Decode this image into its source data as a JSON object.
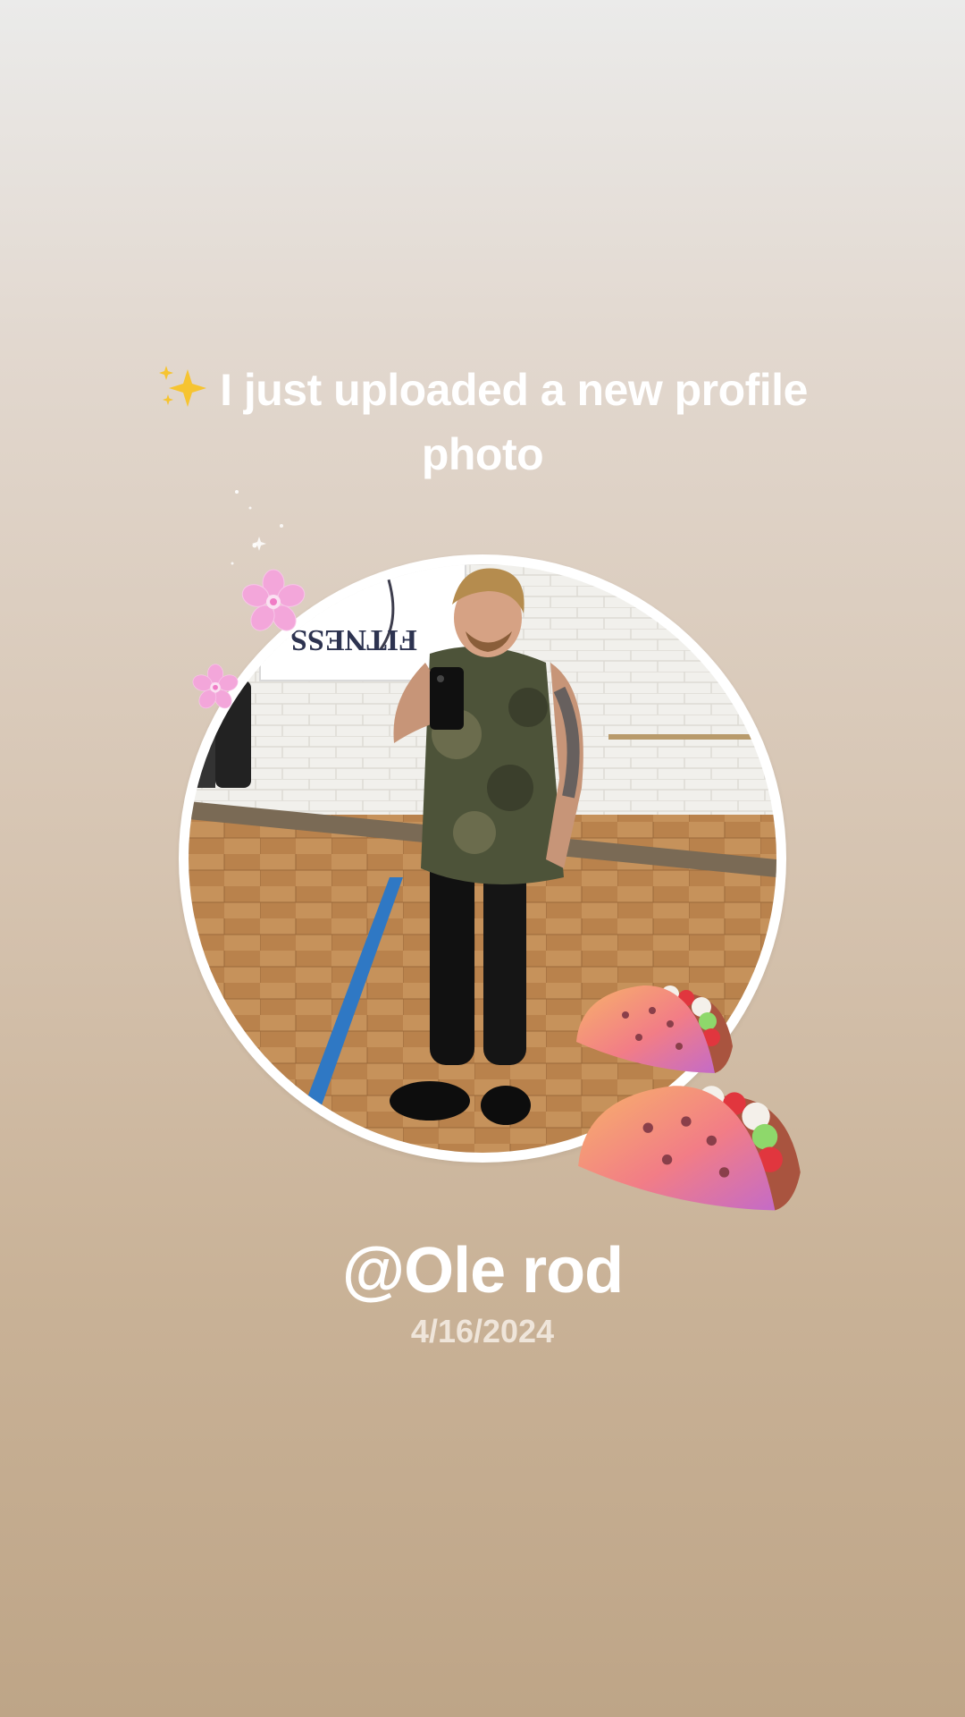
{
  "post": {
    "headline_icon": "sparkles-icon",
    "headline_text": "I just uploaded a new profile photo",
    "username": "@Ole rod",
    "date": "4/16/2024"
  },
  "stickers": [
    "sparkles-icon",
    "cherry-blossom-icon",
    "taco-icon"
  ],
  "photo": {
    "sign_text": "FITNESS"
  },
  "colors": {
    "background_top": "#ebebea",
    "background_bottom": "#bea587",
    "text": "#ffffff",
    "frame": "#ffffff"
  }
}
